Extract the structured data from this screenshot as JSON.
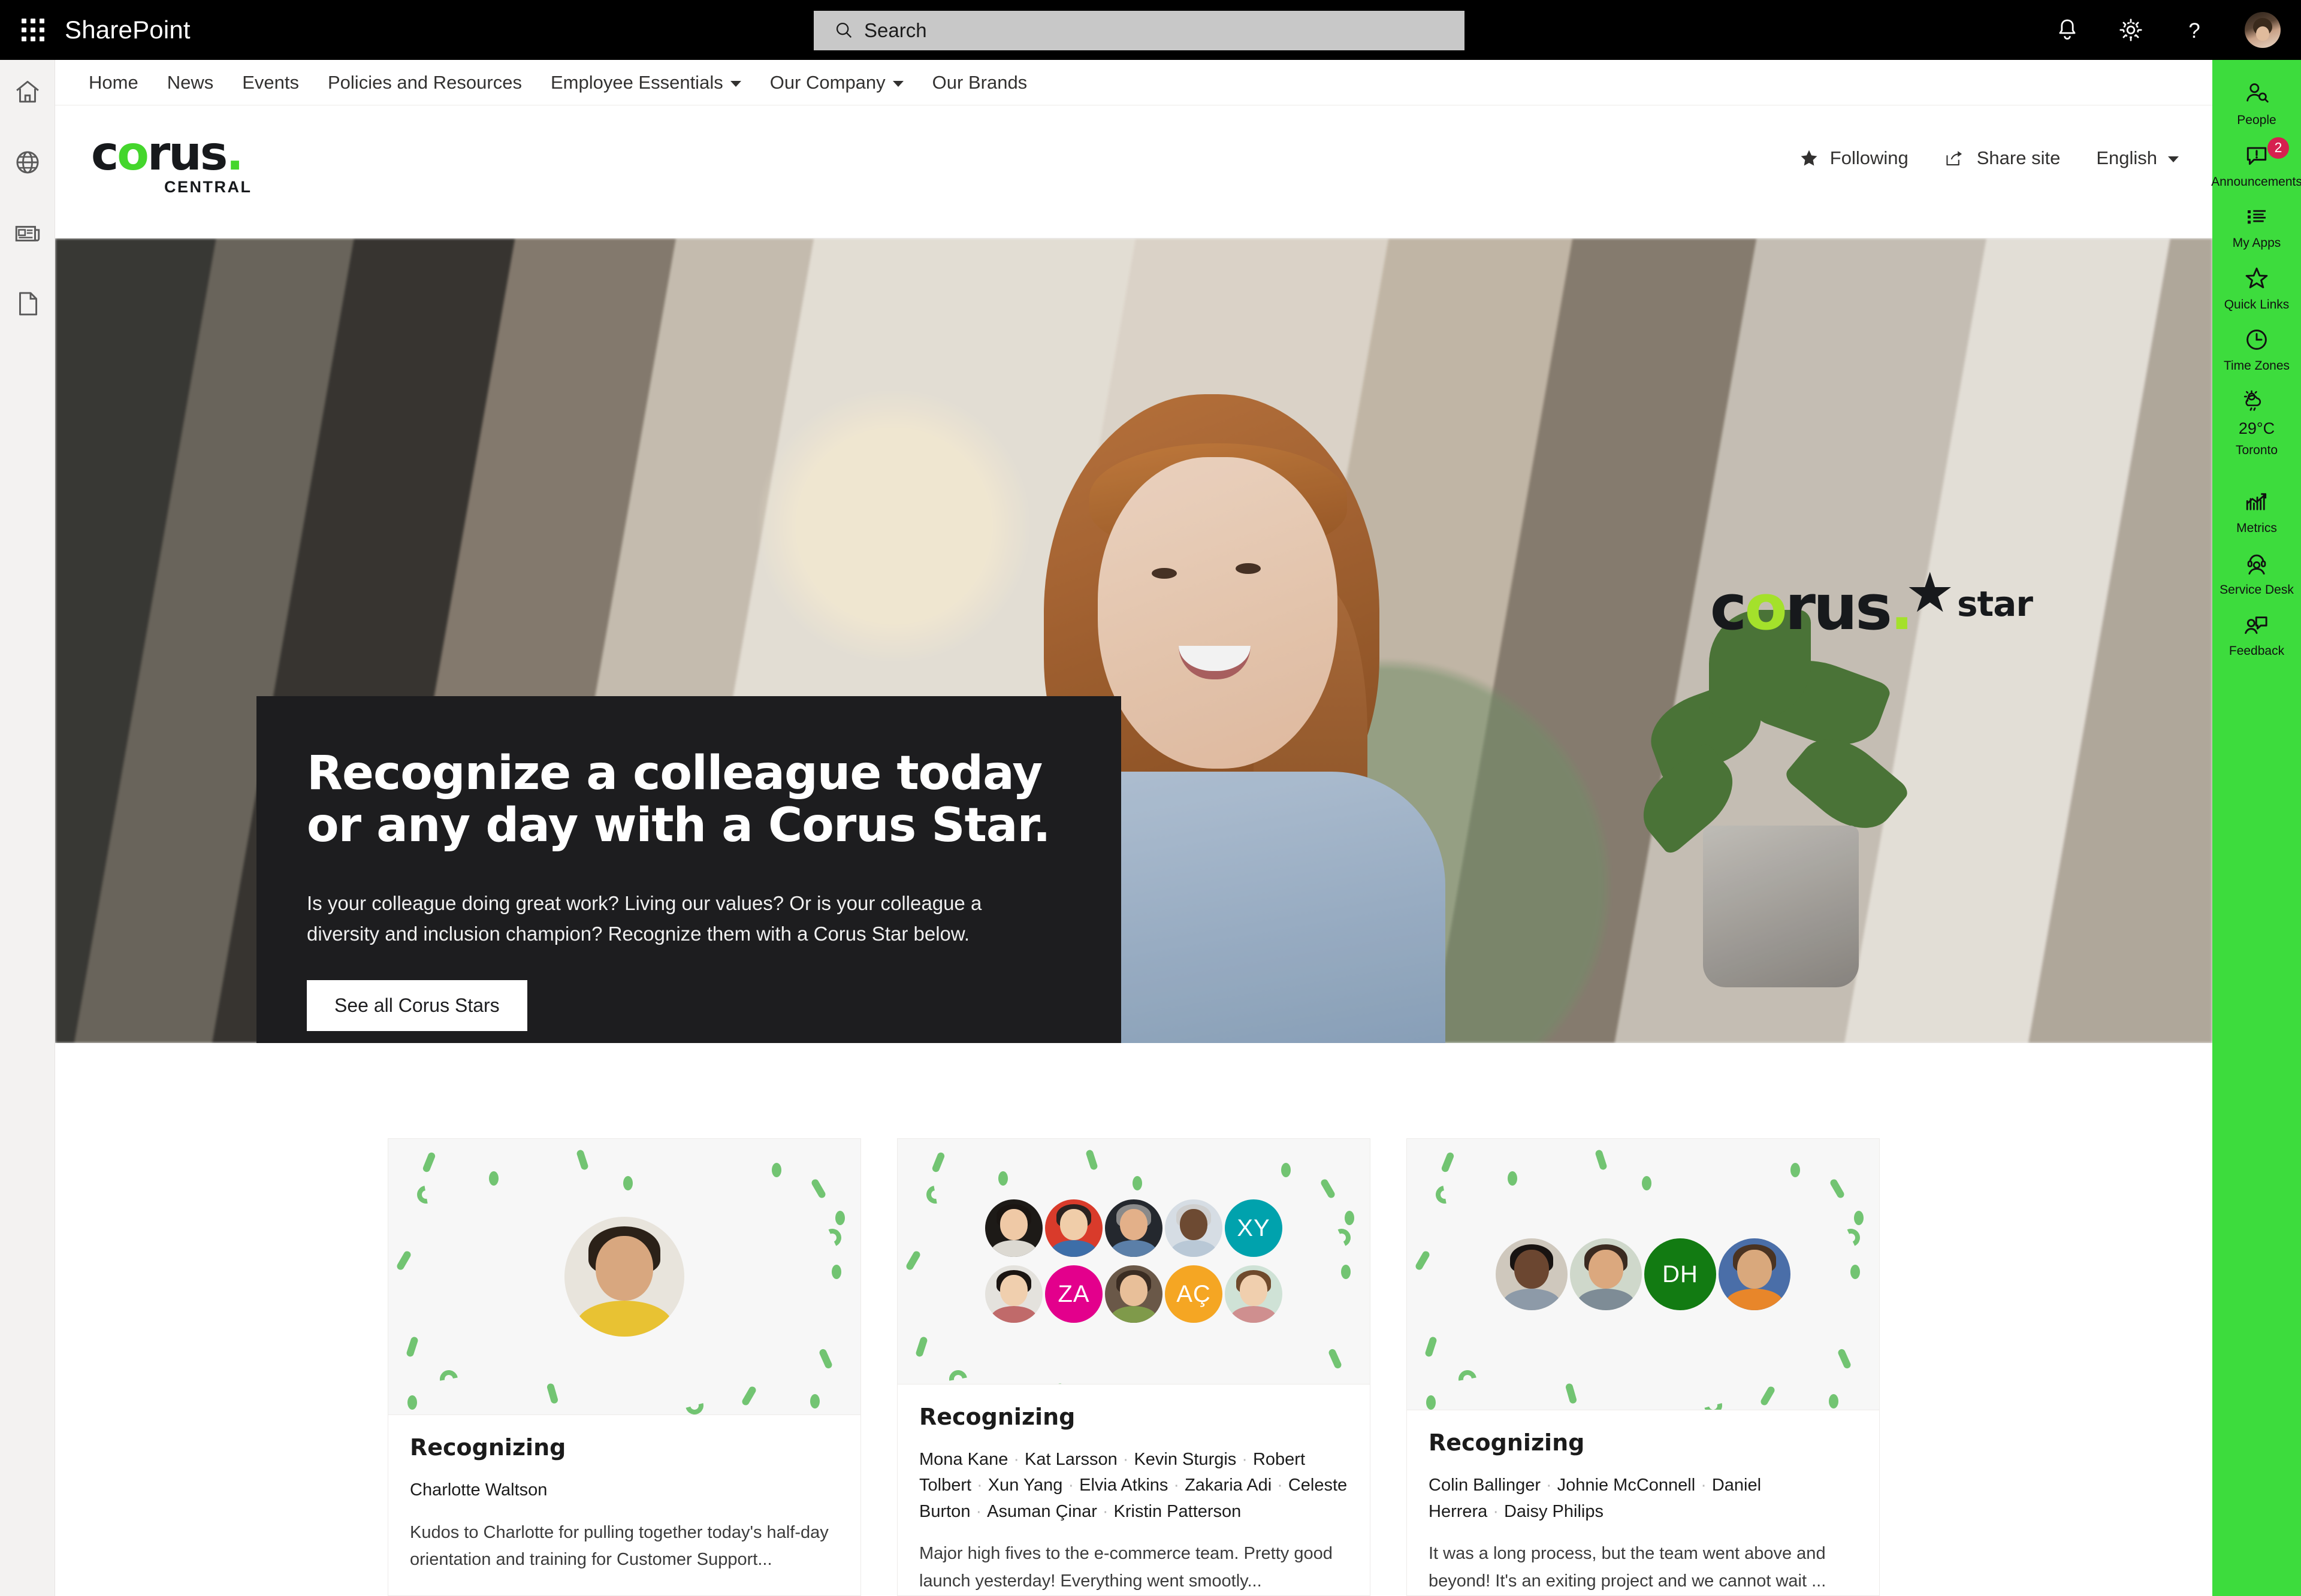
{
  "suitebar": {
    "app_launcher": "app-launcher",
    "title": "SharePoint",
    "search_placeholder": "Search",
    "icons": [
      "notifications-icon",
      "settings-icon",
      "help-icon",
      "account-avatar"
    ]
  },
  "left_rail": {
    "items": [
      {
        "icon": "home-icon",
        "name": "home"
      },
      {
        "icon": "globe-icon",
        "name": "globe"
      },
      {
        "icon": "news-icon",
        "name": "news"
      },
      {
        "icon": "page-icon",
        "name": "page"
      }
    ]
  },
  "site_nav": {
    "items": [
      {
        "label": "Home",
        "has_chevron": false
      },
      {
        "label": "News",
        "has_chevron": false
      },
      {
        "label": "Events",
        "has_chevron": false
      },
      {
        "label": "Policies and Resources",
        "has_chevron": false
      },
      {
        "label": "Employee Essentials",
        "has_chevron": true
      },
      {
        "label": "Our Company",
        "has_chevron": true
      },
      {
        "label": "Our Brands",
        "has_chevron": false
      }
    ]
  },
  "site_header": {
    "logo_word": "corus",
    "logo_sub": "CENTRAL",
    "following_label": "Following",
    "share_label": "Share site",
    "language_label": "English"
  },
  "hero": {
    "brand_word": "corus",
    "brand_star": "star",
    "heading_line1": "Recognize a colleague today",
    "heading_line2": "or any day with a Corus Star.",
    "body": "Is your colleague doing great work? Living our values? Or is your colleague a diversity and inclusion champion? Recognize them with a Corus Star below.",
    "button_label": "See all Corus Stars"
  },
  "cards": [
    {
      "heading": "Recognizing",
      "names": [
        "Charlotte Waltson"
      ],
      "description": "Kudos to Charlotte for pulling together today's half-day orientation and training for Customer Support...",
      "avatars": [
        {
          "type": "photo",
          "skin": "#d8a77f",
          "hair": "#2b2118",
          "bg": "#e8e4dc"
        }
      ]
    },
    {
      "heading": "Recognizing",
      "names": [
        "Mona Kane",
        "Kat Larsson",
        "Kevin Sturgis",
        "Robert Tolbert",
        "Xun Yang",
        "Elvia Atkins",
        "Zakaria Adi",
        "Celeste Burton",
        "Asuman Çinar",
        "Kristin Patterson"
      ],
      "description": "Major high fives to the e-commerce team. Pretty good launch yesterday! Everything went smootly...",
      "avatars": [
        {
          "type": "photo",
          "skin": "#efc9a6",
          "hair": "#1a1512",
          "bg": "#1d1a17"
        },
        {
          "type": "photo",
          "skin": "#f0cda9",
          "hair": "#2a2220",
          "bg": "#d93b2b"
        },
        {
          "type": "photo",
          "skin": "#e3b089",
          "hair": "#8a8a8a",
          "bg": "#24282e"
        },
        {
          "type": "photo",
          "skin": "#6d4a32",
          "hair": "#cfcfcf",
          "bg": "#d6dde4"
        },
        {
          "type": "initials",
          "initials": "XY",
          "color": "#00a2ad"
        },
        {
          "type": "photo",
          "skin": "#f0cfae",
          "hair": "#1b1512",
          "bg": "#e4e2dd"
        },
        {
          "type": "initials",
          "initials": "ZA",
          "color": "#e3008c"
        },
        {
          "type": "photo",
          "skin": "#e8bf99",
          "hair": "#3a2c22",
          "bg": "#6a5848"
        },
        {
          "type": "initials",
          "initials": "AÇ",
          "color": "#f5a623"
        },
        {
          "type": "photo",
          "skin": "#f0cfae",
          "hair": "#6f4a2c",
          "bg": "#cfe2d6"
        }
      ]
    },
    {
      "heading": "Recognizing",
      "names": [
        "Colin Ballinger",
        "Johnie McConnell",
        "Daniel Herrera",
        "Daisy Philips"
      ],
      "description": "It was a long process, but the team went above and beyond! It's an exiting project and we cannot wait ...",
      "avatars": [
        {
          "type": "photo",
          "skin": "#6b4630",
          "hair": "#181311",
          "bg": "#cfc8bd"
        },
        {
          "type": "photo",
          "skin": "#dba87e",
          "hair": "#3a2a20",
          "bg": "#cfd8cb"
        },
        {
          "type": "initials",
          "initials": "DH",
          "color": "#127b12"
        },
        {
          "type": "photo",
          "skin": "#d9a87c",
          "hair": "#4a3322",
          "bg": "#4a6ea8"
        }
      ]
    }
  ],
  "right_rail": {
    "items": [
      {
        "label": "People",
        "icon": "people-icon",
        "badge": null
      },
      {
        "label": "Announcements",
        "icon": "announcements-icon",
        "badge": "2"
      },
      {
        "label": "My Apps",
        "icon": "my-apps-icon",
        "badge": null
      },
      {
        "label": "Quick Links",
        "icon": "star-icon",
        "badge": null
      },
      {
        "label": "Time Zones",
        "icon": "clock-icon",
        "badge": null
      },
      {
        "label": "Toronto",
        "icon": "weather-icon",
        "badge": null,
        "temperature": "29°C"
      },
      {
        "label": "Metrics",
        "icon": "metrics-icon",
        "badge": null
      },
      {
        "label": "Service Desk",
        "icon": "service-desk-icon",
        "badge": null
      },
      {
        "label": "Feedback",
        "icon": "feedback-icon",
        "badge": null
      }
    ]
  },
  "colors": {
    "brand_green": "#3ddc3d",
    "logo_green": "#44d62c",
    "hero_panel": "#1d1d1f",
    "badge_red": "#d6204f",
    "confetti_green": "#72c472"
  }
}
